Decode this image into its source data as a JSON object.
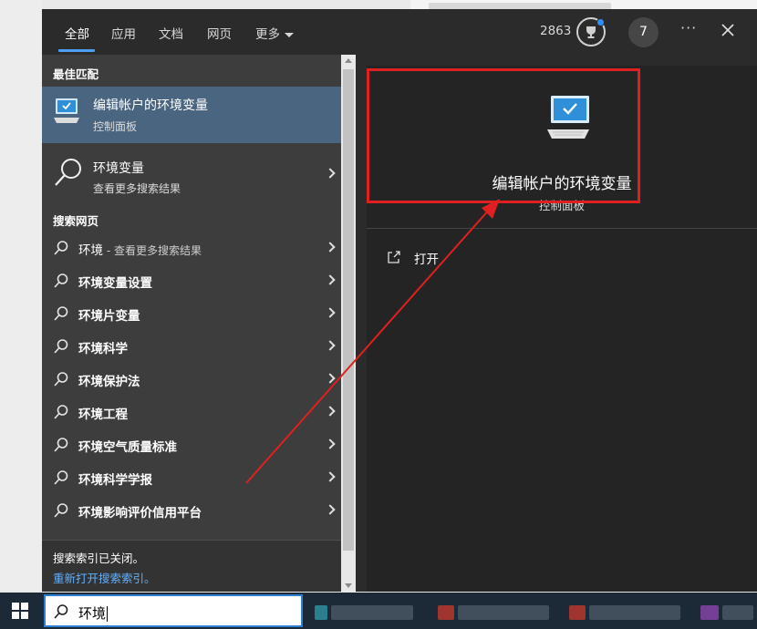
{
  "tabs": [
    {
      "label": "全部"
    },
    {
      "label": "应用"
    },
    {
      "label": "文档"
    },
    {
      "label": "网页"
    },
    {
      "label": "更多"
    }
  ],
  "header": {
    "points": "2863",
    "avatar": "7",
    "more": "···"
  },
  "best_match": {
    "section": "最佳匹配",
    "title": "编辑帐户的环境变量",
    "subtitle": "控制面板"
  },
  "second": {
    "title": "环境变量",
    "subtitle": "查看更多搜索结果"
  },
  "web": {
    "section": "搜索网页",
    "items": [
      {
        "label": "环境",
        "suffix": " - 查看更多搜索结果"
      },
      {
        "label": "环境变量设置",
        "suffix": ""
      },
      {
        "label": "环境片变量",
        "suffix": ""
      },
      {
        "label": "环境科学",
        "suffix": ""
      },
      {
        "label": "环境保护法",
        "suffix": ""
      },
      {
        "label": "环境工程",
        "suffix": ""
      },
      {
        "label": "环境空气质量标准",
        "suffix": ""
      },
      {
        "label": "环境科学学报",
        "suffix": ""
      },
      {
        "label": "环境影响评价信用平台",
        "suffix": ""
      }
    ]
  },
  "footer": {
    "note": "搜索索引已关闭。",
    "link": "重新打开搜索索引。"
  },
  "preview": {
    "title": "编辑帐户的环境变量",
    "subtitle": "控制面板",
    "open_label": "打开"
  },
  "taskbar": {
    "query": "环境"
  },
  "colors": {
    "accent": "#4c9ff2",
    "highlight": "#4a6580",
    "annotation": "#e02020"
  }
}
